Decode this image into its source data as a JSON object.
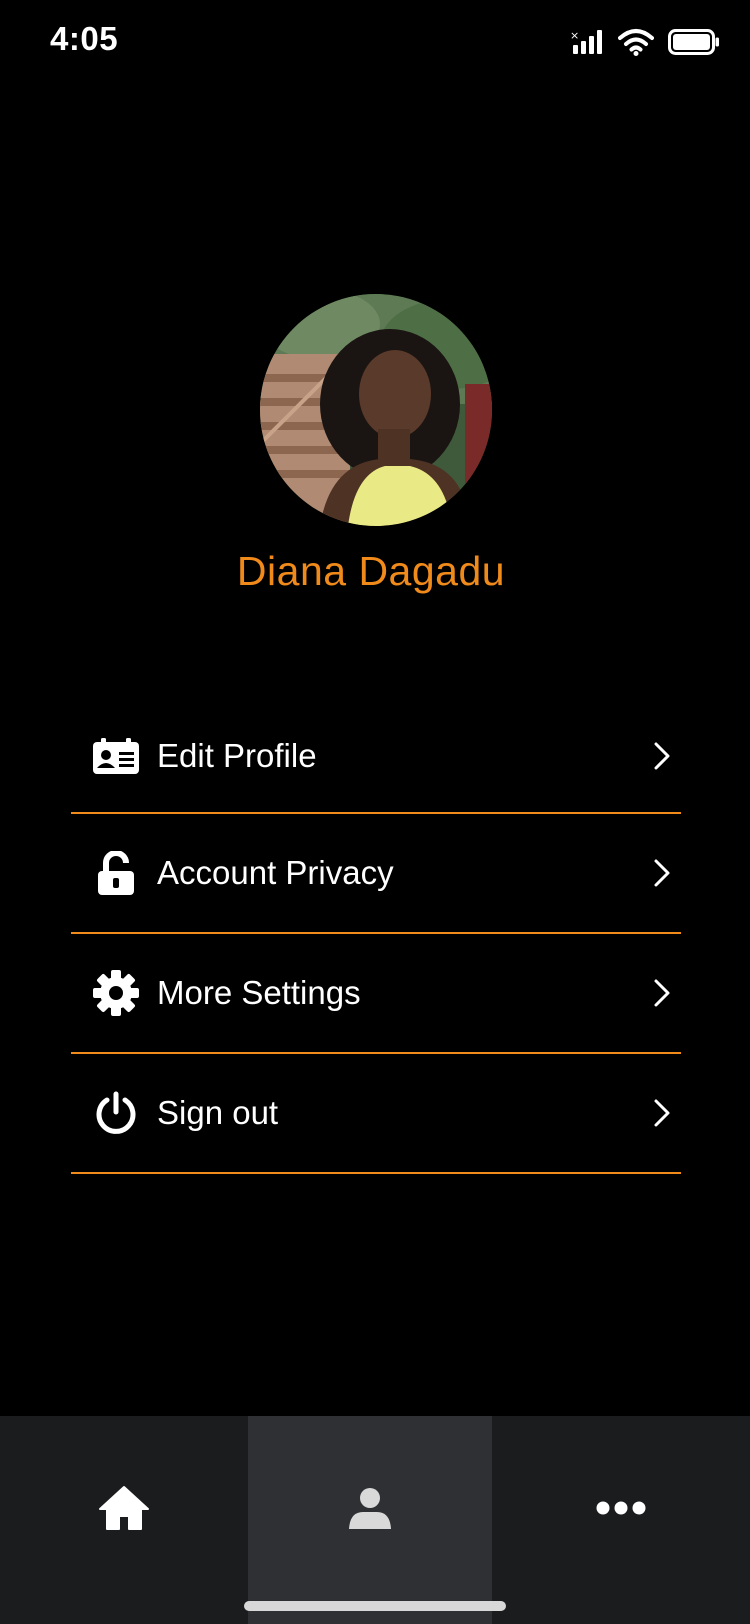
{
  "status_bar": {
    "time": "4:05",
    "icons": [
      "cellular-signal-icon",
      "wifi-icon",
      "battery-icon"
    ]
  },
  "profile": {
    "name": "Diana Dagadu",
    "name_color": "#f08a1a"
  },
  "menu": {
    "divider_color": "#f08a1a",
    "items": [
      {
        "icon": "id-card-icon",
        "label": "Edit Profile"
      },
      {
        "icon": "unlock-icon",
        "label": "Account Privacy"
      },
      {
        "icon": "gear-icon",
        "label": "More Settings"
      },
      {
        "icon": "power-icon",
        "label": "Sign out"
      }
    ]
  },
  "bottom_nav": {
    "tabs": [
      {
        "icon": "home-icon",
        "active": false
      },
      {
        "icon": "user-icon",
        "active": true
      },
      {
        "icon": "more-icon",
        "active": false
      }
    ]
  }
}
